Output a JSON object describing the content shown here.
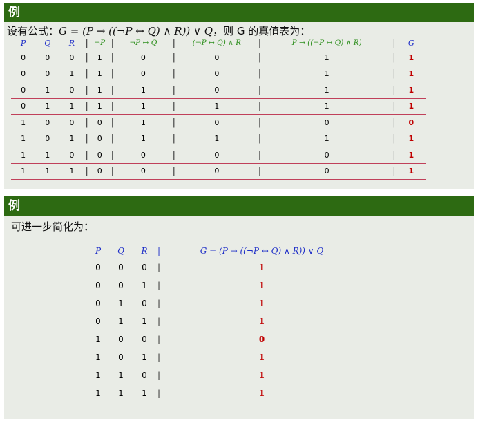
{
  "block1": {
    "title": "例",
    "intro_prefix": "设有公式：",
    "intro_formula": "G = (P → ((¬P ↔ Q) ∧ R)) ∨ Q",
    "intro_suffix": "，则 G 的真值表为：",
    "headers": [
      "P",
      "Q",
      "R",
      "¬P",
      "¬P ↔ Q",
      "(¬P ↔ Q) ∧ R",
      "P → ((¬P ↔ Q) ∧ R)",
      "G"
    ],
    "rows": [
      [
        "0",
        "0",
        "0",
        "1",
        "0",
        "0",
        "1",
        "1"
      ],
      [
        "0",
        "0",
        "1",
        "1",
        "0",
        "0",
        "1",
        "1"
      ],
      [
        "0",
        "1",
        "0",
        "1",
        "1",
        "0",
        "1",
        "1"
      ],
      [
        "0",
        "1",
        "1",
        "1",
        "1",
        "1",
        "1",
        "1"
      ],
      [
        "1",
        "0",
        "0",
        "0",
        "1",
        "0",
        "0",
        "0"
      ],
      [
        "1",
        "0",
        "1",
        "0",
        "1",
        "1",
        "1",
        "1"
      ],
      [
        "1",
        "1",
        "0",
        "0",
        "0",
        "0",
        "0",
        "1"
      ],
      [
        "1",
        "1",
        "1",
        "0",
        "0",
        "0",
        "0",
        "1"
      ]
    ]
  },
  "block2": {
    "title": "例",
    "intro": "可进一步简化为：",
    "headers": [
      "P",
      "Q",
      "R",
      "G = (P → ((¬P ↔ Q) ∧ R)) ∨ Q"
    ],
    "rows": [
      [
        "0",
        "0",
        "0",
        "1"
      ],
      [
        "0",
        "0",
        "1",
        "1"
      ],
      [
        "0",
        "1",
        "0",
        "1"
      ],
      [
        "0",
        "1",
        "1",
        "1"
      ],
      [
        "1",
        "0",
        "0",
        "0"
      ],
      [
        "1",
        "0",
        "1",
        "1"
      ],
      [
        "1",
        "1",
        "0",
        "1"
      ],
      [
        "1",
        "1",
        "1",
        "1"
      ]
    ]
  },
  "colors": {
    "header_bg": "#2d6a12",
    "block_bg": "#e9ece6",
    "rule": "#c0405a",
    "true_value": "#c00000",
    "var_header": "#2030c8",
    "sub_header": "#2e8f1e"
  }
}
